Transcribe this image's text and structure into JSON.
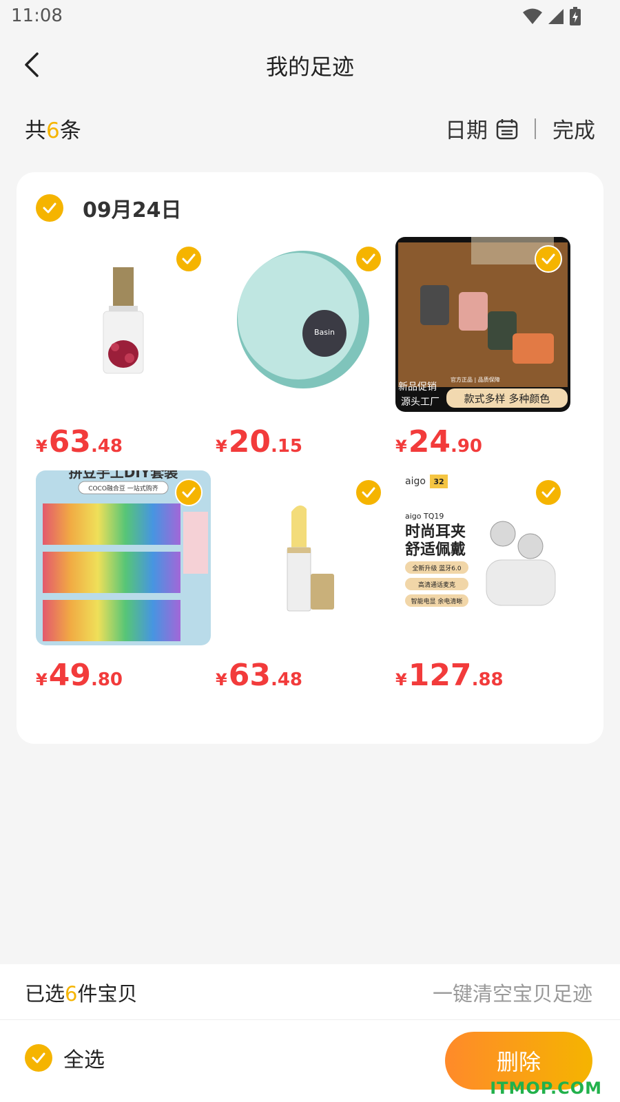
{
  "status": {
    "time": "11:08"
  },
  "nav": {
    "title": "我的足迹"
  },
  "summary": {
    "prefix": "共",
    "count": "6",
    "suffix": "条"
  },
  "toolbar": {
    "date_label": "日期",
    "done_label": "完成"
  },
  "group": {
    "date": "09月24日"
  },
  "products": [
    {
      "name": "perfume",
      "yen": "¥",
      "price_int": "63",
      "price_dec": ".48"
    },
    {
      "name": "basin",
      "yen": "¥",
      "price_int": "20",
      "price_dec": ".15",
      "img_text": [
        "Basin"
      ]
    },
    {
      "name": "game-console-eraser",
      "yen": "¥",
      "price_int": "24",
      "price_dec": ".90",
      "img_text": [
        "新品促销",
        "源头工厂",
        "官方正品 | 品质保障",
        "款式多样 多种颜色"
      ]
    },
    {
      "name": "bead-set",
      "yen": "¥",
      "price_int": "49",
      "price_dec": ".80",
      "img_text": [
        "拼豆手工DIY套装",
        "COCO融合豆 一站式购齐"
      ]
    },
    {
      "name": "lip-balm",
      "yen": "¥",
      "price_int": "63",
      "price_dec": ".48"
    },
    {
      "name": "earphones",
      "yen": "¥",
      "price_int": "127",
      "price_dec": ".88",
      "img_text": [
        "aigo",
        "32",
        "aigo TQ19",
        "时尚耳夹",
        "舒适佩戴",
        "全新升级 蓝牙6.0",
        "高清通话麦克",
        "智能电显 余电清晰"
      ]
    }
  ],
  "bottom": {
    "selected_prefix": "已选",
    "selected_count": "6",
    "selected_suffix": "件宝贝",
    "clear_label": "一键清空宝贝足迹",
    "select_all_label": "全选",
    "delete_label": "删除"
  },
  "watermark": "ITMOP.COM",
  "colors": {
    "accent": "#f5b400",
    "price": "#f23b3b",
    "background": "#f5f5f5"
  }
}
